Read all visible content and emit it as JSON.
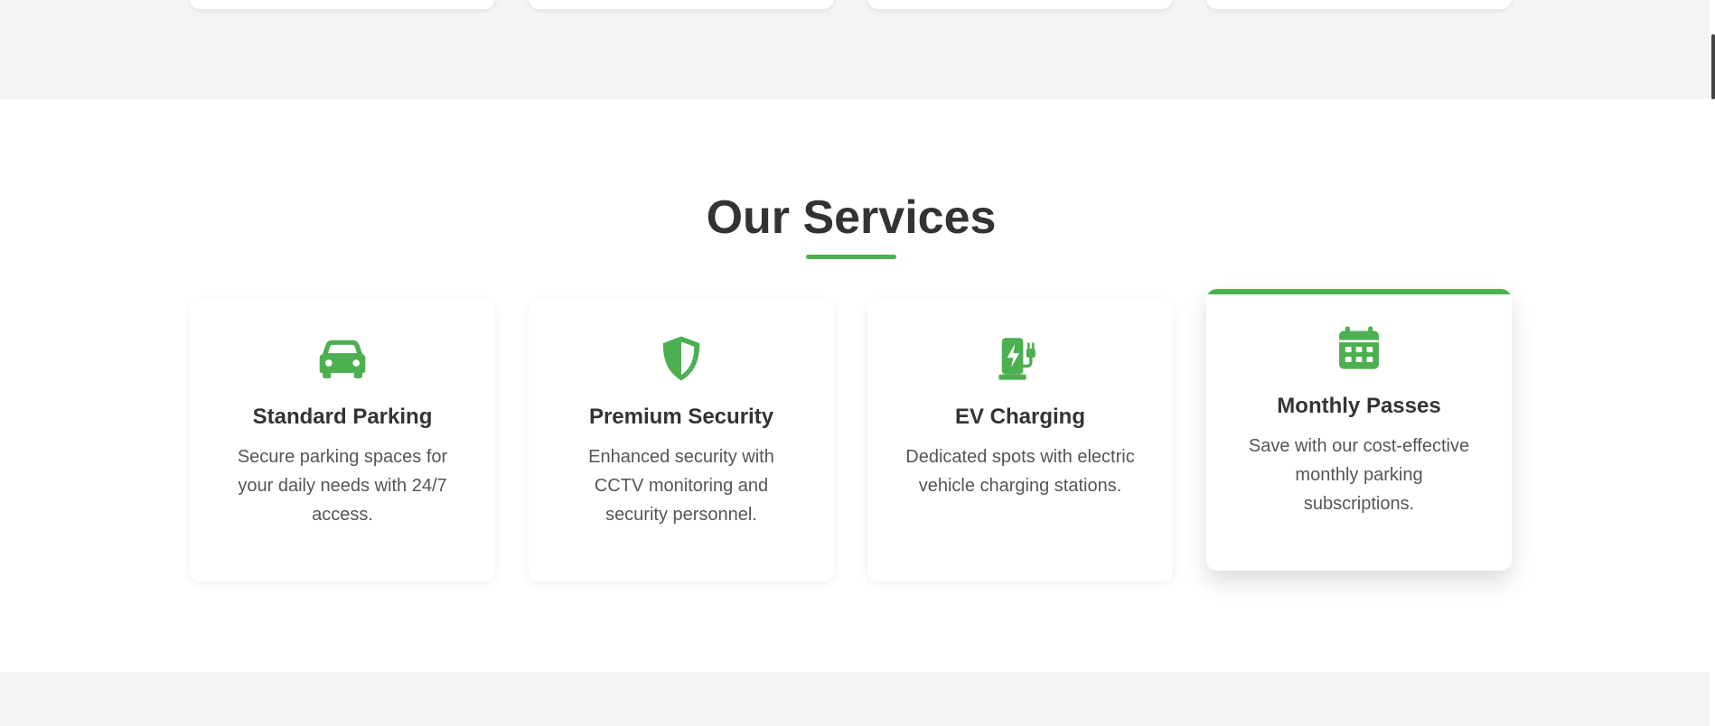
{
  "colors": {
    "accent": "#4caf50",
    "heading": "#333333",
    "body_text": "#555555",
    "section_bg": "#ffffff",
    "page_bg": "#f4f4f4"
  },
  "services": {
    "title": "Our Services",
    "cards": [
      {
        "icon": "car-icon",
        "title": "Standard Parking",
        "description": "Secure parking spaces for your daily needs with 24/7 access."
      },
      {
        "icon": "shield-icon",
        "title": "Premium Security",
        "description": "Enhanced security with CCTV monitoring and security personnel."
      },
      {
        "icon": "charging-station-icon",
        "title": "EV Charging",
        "description": "Dedicated spots with electric vehicle charging stations."
      },
      {
        "icon": "calendar-icon",
        "title": "Monthly Passes",
        "description": "Save with our cost-effective monthly parking subscriptions."
      }
    ]
  }
}
